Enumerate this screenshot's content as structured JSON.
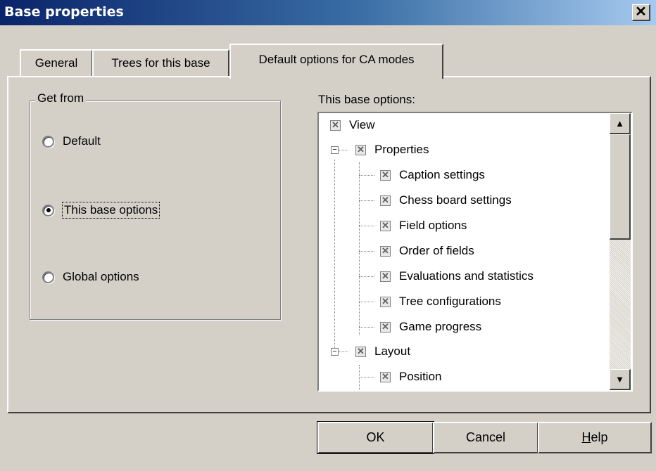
{
  "window": {
    "title": "Base properties",
    "close_glyph": "✕"
  },
  "tabs": [
    {
      "label": "General",
      "active": false
    },
    {
      "label": "Trees for this base",
      "active": false
    },
    {
      "label": "Default options for CA modes",
      "active": true
    }
  ],
  "get_from": {
    "title": "Get from",
    "options": [
      {
        "label": "Default",
        "selected": false
      },
      {
        "label": "This base options",
        "selected": true
      },
      {
        "label": "Global options",
        "selected": false
      }
    ]
  },
  "options_tree": {
    "label": "This base options:",
    "check_glyph": "✕",
    "items": [
      {
        "label": "View",
        "level": 0,
        "checked": true
      },
      {
        "label": "Properties",
        "level": 0,
        "checked": true,
        "expander": "−"
      },
      {
        "label": "Caption settings",
        "level": 1,
        "checked": true
      },
      {
        "label": "Chess board settings",
        "level": 1,
        "checked": true
      },
      {
        "label": "Field options",
        "level": 1,
        "checked": true
      },
      {
        "label": "Order of fields",
        "level": 1,
        "checked": true
      },
      {
        "label": "Evaluations and statistics",
        "level": 1,
        "checked": true
      },
      {
        "label": "Tree configurations",
        "level": 1,
        "checked": true
      },
      {
        "label": "Game progress",
        "level": 1,
        "checked": true
      },
      {
        "label": "Layout",
        "level": 0,
        "checked": true,
        "expander": "−"
      },
      {
        "label": "Position",
        "level": 1,
        "checked": true
      }
    ],
    "scroll_up_glyph": "▲",
    "scroll_down_glyph": "▼"
  },
  "buttons": {
    "ok": "OK",
    "cancel": "Cancel",
    "help_mnemonic": "H",
    "help_rest": "elp"
  }
}
